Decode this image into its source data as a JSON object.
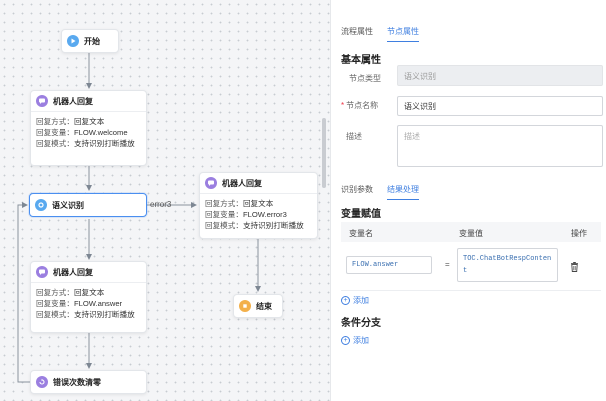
{
  "canvas": {
    "start_node": {
      "title": "开始"
    },
    "robot_reply_1": {
      "title": "机器人回复",
      "rows": [
        {
          "key": "回复方式：",
          "value": "回复文本"
        },
        {
          "key": "回复变量：",
          "value": "FLOW.welcome"
        },
        {
          "key": "回复模式：",
          "value": "支持识别打断播放"
        }
      ]
    },
    "semantic_node": {
      "title": "语义识别"
    },
    "edge_label": "error3",
    "robot_reply_error": {
      "title": "机器人回复",
      "rows": [
        {
          "key": "回复方式：",
          "value": "回复文本"
        },
        {
          "key": "回复变量：",
          "value": "FLOW.error3"
        },
        {
          "key": "回复模式：",
          "value": "支持识别打断播放"
        }
      ]
    },
    "end_node": {
      "title": "结束"
    },
    "robot_reply_2": {
      "title": "机器人回复",
      "rows": [
        {
          "key": "回复方式：",
          "value": "回复文本"
        },
        {
          "key": "回复变量：",
          "value": "FLOW.answer"
        },
        {
          "key": "回复模式：",
          "value": "支持识别打断播放"
        }
      ]
    },
    "reset_node": {
      "title": "错误次数清零"
    }
  },
  "panel": {
    "tabs": [
      "流程属性",
      "节点属性"
    ],
    "active_tab": 1,
    "basic_section_title": "基本属性",
    "node_type_label": "节点类型",
    "node_type_value": "语义识别",
    "node_name_required": "*",
    "node_name_label": "节点名称",
    "node_name_value": "语义识别",
    "desc_label": "描述",
    "desc_placeholder": "描述",
    "sub_tabs": [
      "识别参数",
      "结果处理"
    ],
    "active_sub_tab": 1,
    "assign_section_title": "变量赋值",
    "table_headers": {
      "name": "变量名",
      "value": "变量值",
      "op": "操作"
    },
    "assign_rows": [
      {
        "name": "FLOW.answer",
        "eq": "=",
        "value_line1": "TOC.ChatBotRespConten",
        "value_line2": "t"
      }
    ],
    "add_label": "添加",
    "branch_section_title": "条件分支",
    "add_label_2": "添加"
  }
}
